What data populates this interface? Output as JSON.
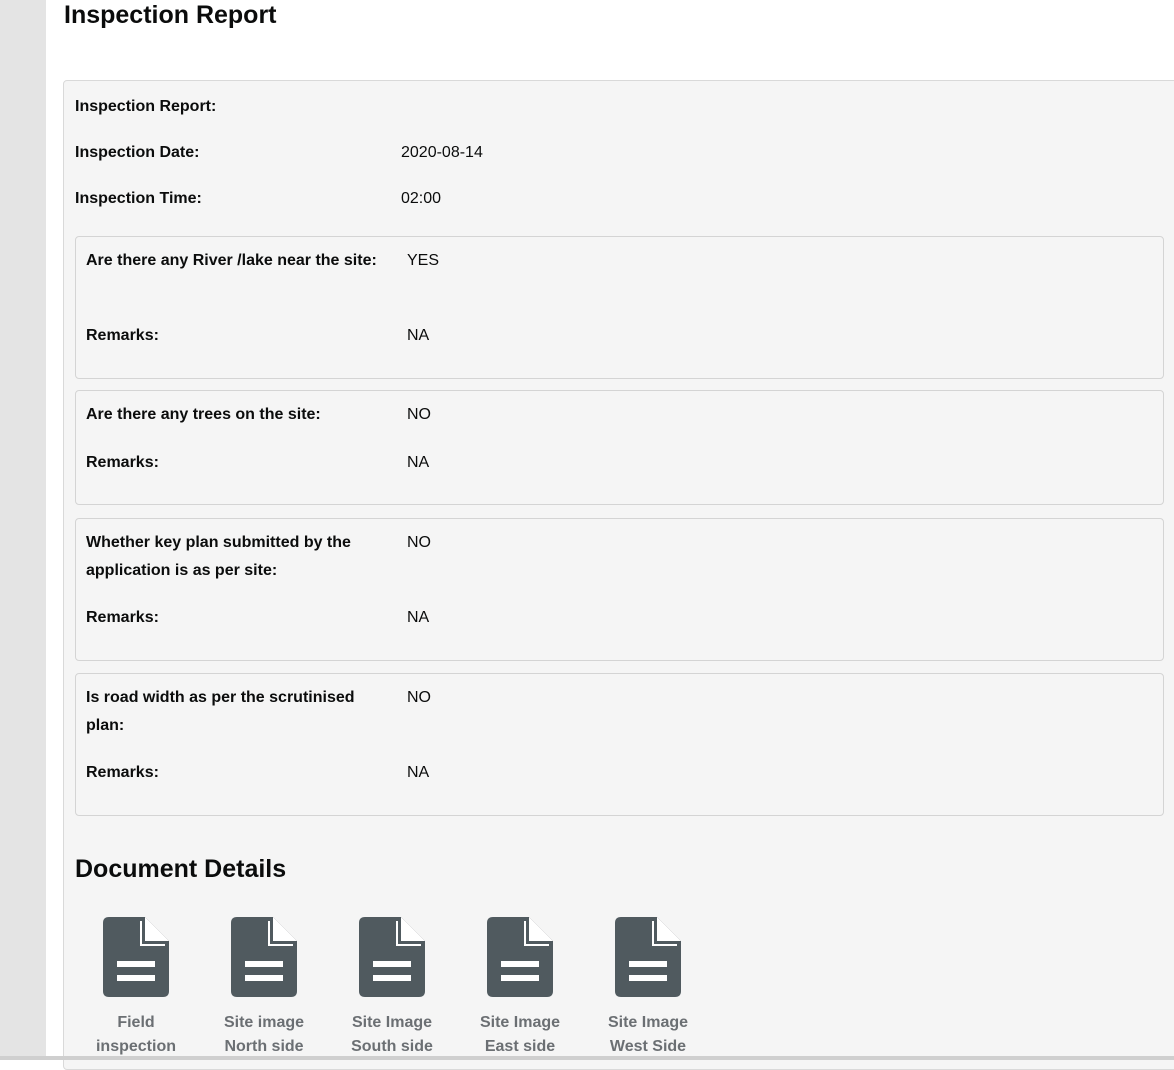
{
  "page": {
    "title": "Inspection Report"
  },
  "report": {
    "heading": "Inspection Report:",
    "date_label": "Inspection Date:",
    "date_value": "2020-08-14",
    "time_label": "Inspection Time:",
    "time_value": "02:00"
  },
  "questions": [
    {
      "question": "Are there any River /lake near the site:",
      "answer": "YES",
      "remarks_label": "Remarks:",
      "remarks": "NA"
    },
    {
      "question": "Are there any trees on the site:",
      "answer": "NO",
      "remarks_label": "Remarks:",
      "remarks": "NA"
    },
    {
      "question": "Whether key plan submitted by the application is as per site:",
      "answer": "NO",
      "remarks_label": "Remarks:",
      "remarks": "NA"
    },
    {
      "question": "Is road width as per the scrutinised plan:",
      "answer": "NO",
      "remarks_label": "Remarks:",
      "remarks": "NA"
    }
  ],
  "documents": {
    "title": "Document Details",
    "icon": "document-icon",
    "icon_color": "#505a5f",
    "items": [
      {
        "label": "Field inspection"
      },
      {
        "label": "Site image North side"
      },
      {
        "label": "Site Image South side"
      },
      {
        "label": "Site Image East side"
      },
      {
        "label": "Site Image West Side"
      }
    ]
  }
}
